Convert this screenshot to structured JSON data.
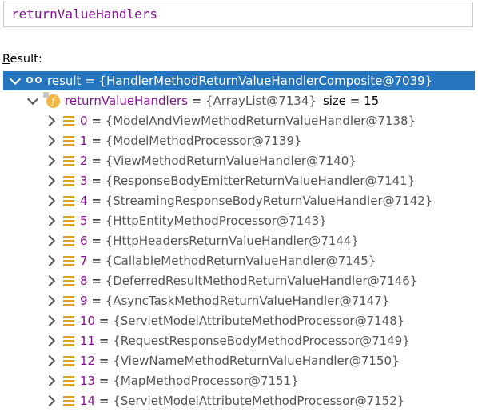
{
  "expression": {
    "text": "returnValueHandlers"
  },
  "result": {
    "label_mnemonic": "R",
    "label_rest": "esult:",
    "root": {
      "name": "result",
      "eq": " = ",
      "value": "{HandlerMethodReturnValueHandlerComposite@7039}"
    },
    "field": {
      "name": "returnValueHandlers",
      "eq": " = ",
      "value": "{ArrayList@7134}",
      "size": "size = 15"
    },
    "items": [
      {
        "index": "0",
        "value": "{ModelAndViewMethodReturnValueHandler@7138}"
      },
      {
        "index": "1",
        "value": "{ModelMethodProcessor@7139}"
      },
      {
        "index": "2",
        "value": "{ViewMethodReturnValueHandler@7140}"
      },
      {
        "index": "3",
        "value": "{ResponseBodyEmitterReturnValueHandler@7141}"
      },
      {
        "index": "4",
        "value": "{StreamingResponseBodyReturnValueHandler@7142}"
      },
      {
        "index": "5",
        "value": "{HttpEntityMethodProcessor@7143}"
      },
      {
        "index": "6",
        "value": "{HttpHeadersReturnValueHandler@7144}"
      },
      {
        "index": "7",
        "value": "{CallableMethodReturnValueHandler@7145}"
      },
      {
        "index": "8",
        "value": "{DeferredResultMethodReturnValueHandler@7146}"
      },
      {
        "index": "9",
        "value": "{AsyncTaskMethodReturnValueHandler@7147}"
      },
      {
        "index": "10",
        "value": "{ServletModelAttributeMethodProcessor@7148}"
      },
      {
        "index": "11",
        "value": "{RequestResponseBodyMethodProcessor@7149}"
      },
      {
        "index": "12",
        "value": "{ViewNameMethodReturnValueHandler@7150}"
      },
      {
        "index": "13",
        "value": "{MapMethodProcessor@7151}"
      },
      {
        "index": "14",
        "value": "{ServletModelAttributeMethodProcessor@7152}"
      }
    ]
  },
  "icons": {
    "root": "watch-glasses-icon",
    "field": "field-icon",
    "item": "list-icon"
  },
  "colors": {
    "selection": "#2675bf",
    "keyword": "#871094",
    "field_icon": "#f2b541",
    "list_icon": "#d8a527"
  }
}
